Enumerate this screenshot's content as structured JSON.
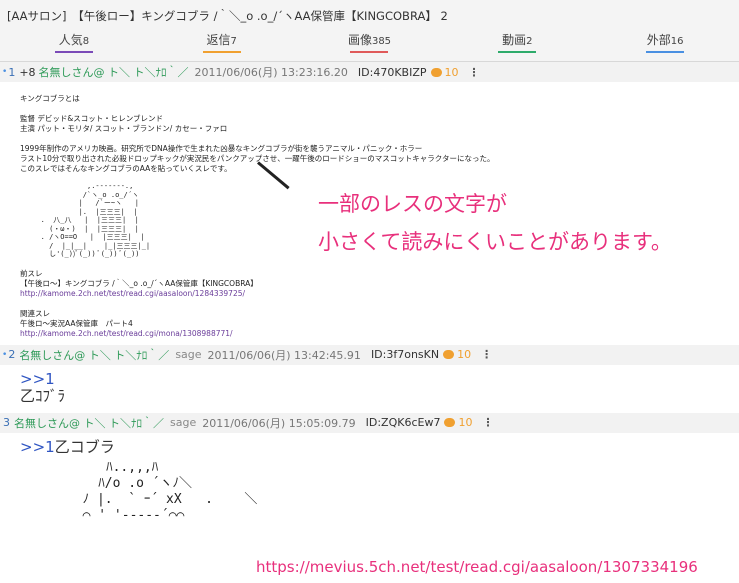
{
  "thread": {
    "title": "[AAサロン]　【午後ロー】キングコブラ /｀＼_o .o_/´ヽAA保管庫【KINGCOBRA】 2"
  },
  "tabs": [
    {
      "label": "人気",
      "count": "8",
      "color": "#7b4bb8"
    },
    {
      "label": "返信",
      "count": "7",
      "color": "#f0a030"
    },
    {
      "label": "画像",
      "count": "385",
      "color": "#e05a5a"
    },
    {
      "label": "動画",
      "count": "2",
      "color": "#2eab6b"
    },
    {
      "label": "外部",
      "count": "16",
      "color": "#4a90e2"
    }
  ],
  "posts": [
    {
      "mark": "•",
      "num": "1",
      "rate": "+8",
      "name": "名無しさん@ ト＼ ト＼ﾅﾛ｀／",
      "mail": "",
      "date": "2011/06/06(月) 13:23:16.20",
      "id": "ID:470KBIZP",
      "reply_count": "10",
      "body": {
        "l1": "キングコブラとは",
        "l2": "監督 デビッド&スコット・ヒレンブレンド",
        "l3": "主演 パット・モリタ/ スコット・ブランドン/ カセー・ファロ",
        "l4": "1999年制作のアメリカ映画。研究所でDNA操作で生まれた凶暴なキングコブラが街を襲うアニマル・パニック・ホラー",
        "l5": "ラスト10分で取り出された必殺ドロップキックが実況民をパンクアップさせ、一躍午後のロードショーのマスコットキャラクターになった。",
        "l6": "このスレではそんなキングコブラのAAを貼っていくスレです。",
        "aa": "              ,.-------.,\n             /`ヽ_o .o_/´ヽ\n            |   /`ー~ヽ   |\n            |.  |三三三|  |\n   .  八_八   |  |三三三|  |\n     (・ω・)  |  |三三三|  |\n   . /ヽO==O   |  |三三三|  |\n     /  |_|__|    |_|三三三|_|\n     し'(_))ﾞ(_)) ﾞ(_)) ﾞ(_))",
        "prev_label": "前スレ",
        "prev_title": "【午後ロ～】キングコブラ /｀＼_o .o_/´ヽAA保管庫【KINGCOBRA】",
        "prev_url": "http://kamome.2ch.net/test/read.cgi/aasaloon/1284339725/",
        "rel_label": "関連スレ",
        "rel_title": "午後ロ～実況AA保管庫　パート4",
        "rel_url": "http://kamome.2ch.net/test/read.cgi/mona/1308988771/"
      }
    },
    {
      "mark": "•",
      "num": "2",
      "name": "名無しさん@ ト＼ ト＼ﾅﾛ｀／",
      "mail": "sage",
      "date": "2011/06/06(月) 13:42:45.91",
      "id": "ID:3f7onsKN",
      "reply_count": "10",
      "anchor": ">>1",
      "text": "乙ｺﾌﾞﾗ"
    },
    {
      "mark": "",
      "num": "3",
      "name": "名無しさん@ ト＼ ト＼ﾅﾛ｀／",
      "mail": "sage",
      "date": "2011/06/06(月) 15:05:09.79",
      "id": "ID:ZQK6cEw7",
      "reply_count": "10",
      "anchor": ">>1",
      "text": "乙コブラ",
      "aa": "           ﾊ..,,,ﾊ\n          ﾊ/o .o ´ヽﾉ＼\n        ﾉ |.  ` ｰ´ xX   .    ＼\n        ⌒ ' '-----´⌒⌒"
    }
  ],
  "annotation": {
    "line1": "一部のレスの文字が",
    "line2": "小さくて読みにくいことがあります。",
    "color": "#e8307c"
  },
  "source_url": "https://mevius.5ch.net/test/read.cgi/aasaloon/1307334196"
}
